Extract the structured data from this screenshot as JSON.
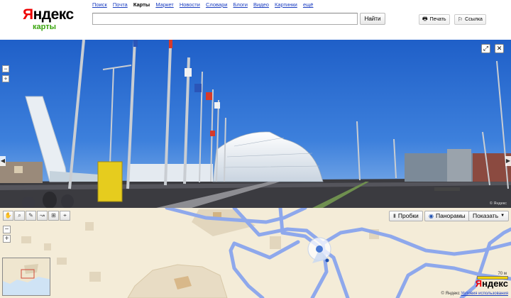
{
  "logo": {
    "first_letter": "Я",
    "rest": "ндекс",
    "sub": "карты"
  },
  "services": [
    "Поиск",
    "Почта",
    "Карты",
    "Маркет",
    "Новости",
    "Словари",
    "Блоги",
    "Видео",
    "Картинки",
    "ещё"
  ],
  "active_service": "Карты",
  "search": {
    "value": "",
    "button": "Найти"
  },
  "header_buttons": {
    "print": "Печать",
    "link": "Ссылка"
  },
  "pano_controls": {
    "zoom_out": "−",
    "zoom_in": "+",
    "left_arrow": "◀",
    "right_arrow": "▶"
  },
  "pano_copyright": "© Яндекс",
  "map": {
    "tools": [
      "hand",
      "magnifier",
      "ruler",
      "route",
      "layers",
      "placemark"
    ],
    "buttons": {
      "traffic": "Пробки",
      "panoramas": "Панорамы",
      "show": "Показать"
    },
    "zoom_out": "−",
    "zoom_in": "+",
    "scale_label": "70 м",
    "logo_first": "Я",
    "logo_rest": "ндекс",
    "copyright": "© Яндекс",
    "terms": "Условия использования"
  },
  "colors": {
    "link": "#1a3dc1",
    "logo_red": "#e00000",
    "logo_green": "#3aa50f",
    "route": "#8ea8ec",
    "map_bg": "#f4ecd8",
    "sky": "#2f6fd1"
  }
}
